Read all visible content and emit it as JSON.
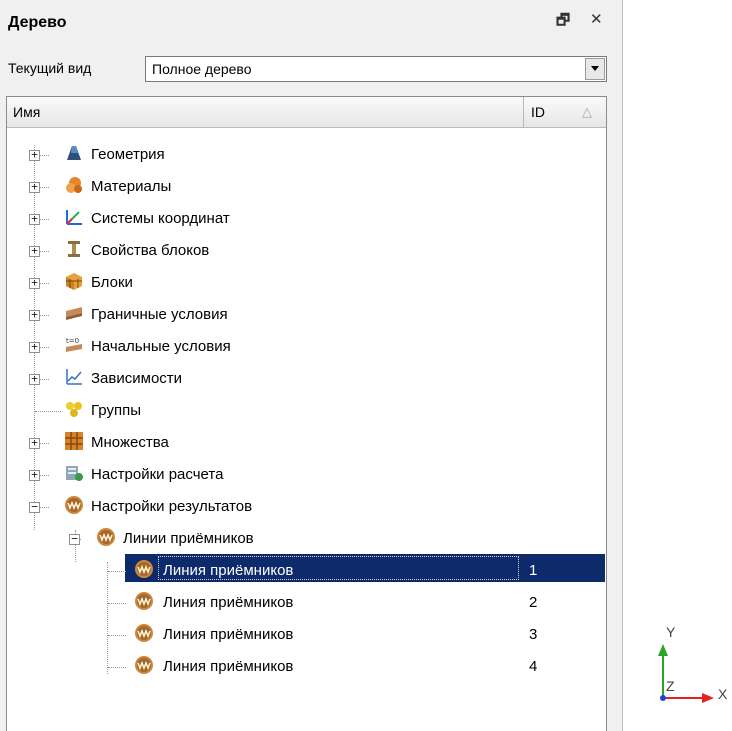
{
  "panel": {
    "title": "Дерево",
    "float_btn": "🗗",
    "close_btn": "✕",
    "view_label": "Текущий вид",
    "view_value": "Полное дерево"
  },
  "tree": {
    "header": {
      "name": "Имя",
      "id": "ID"
    },
    "items": [
      {
        "label": "Геометрия",
        "icon": "geometry-icon"
      },
      {
        "label": "Материалы",
        "icon": "materials-icon"
      },
      {
        "label": "Системы координат",
        "icon": "coordinate-systems-icon"
      },
      {
        "label": "Свойства блоков",
        "icon": "block-properties-icon"
      },
      {
        "label": "Блоки",
        "icon": "blocks-icon"
      },
      {
        "label": "Граничные условия",
        "icon": "boundary-conditions-icon"
      },
      {
        "label": "Начальные условия",
        "icon": "initial-conditions-icon"
      },
      {
        "label": "Зависимости",
        "icon": "dependencies-icon"
      },
      {
        "label": "Группы",
        "icon": "groups-icon"
      },
      {
        "label": "Множества",
        "icon": "sets-icon"
      },
      {
        "label": "Настройки расчета",
        "icon": "calc-settings-icon"
      },
      {
        "label": "Настройки результатов",
        "icon": "result-settings-icon"
      },
      {
        "label": "Линии приёмников",
        "icon": "receiver-lines-icon"
      }
    ],
    "leaves": [
      {
        "label": "Линия приёмников",
        "id": "1"
      },
      {
        "label": "Линия приёмников",
        "id": "2"
      },
      {
        "label": "Линия приёмников",
        "id": "3"
      },
      {
        "label": "Линия приёмников",
        "id": "4"
      }
    ]
  },
  "axes": {
    "y": "Y",
    "z": "Z",
    "x": "X"
  }
}
